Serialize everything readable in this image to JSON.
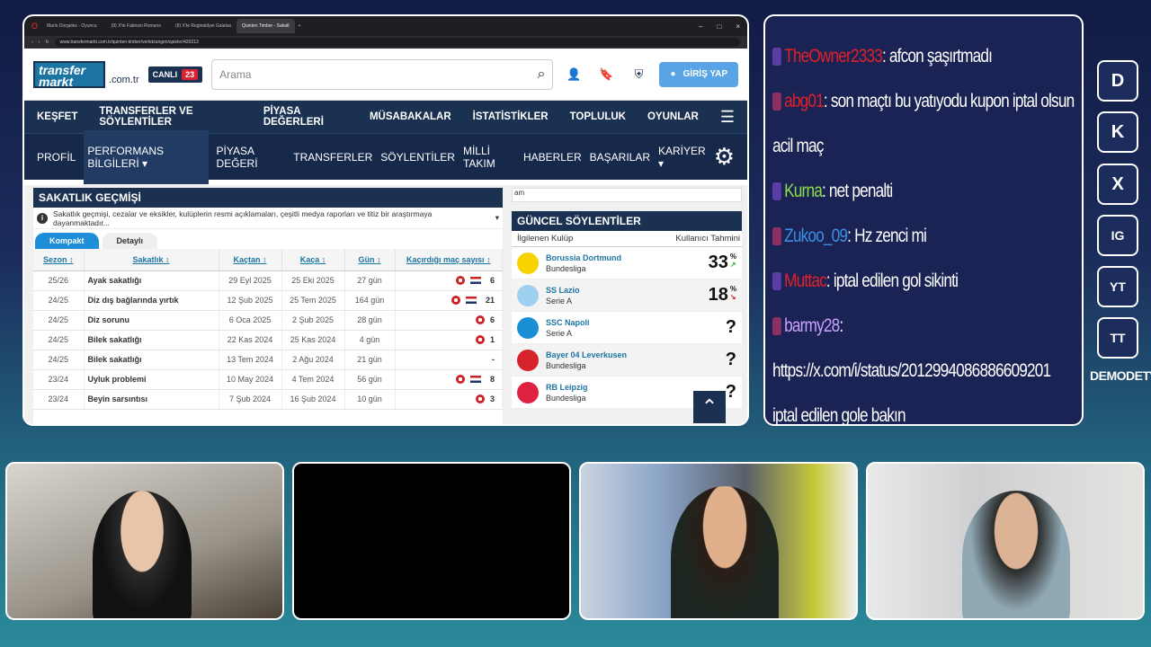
{
  "browser": {
    "tabs": [
      "Mario Dorgeles - Oyuncu",
      "(9) X'te Fabrizio Romano",
      "(9) X'te Reginaldyei Galatas",
      "Quinten Timber - Sakatl"
    ],
    "url": "www.transfermarkt.com.tr/quinten-timber/verletzungen/spieler/420213"
  },
  "site": {
    "logo_line1": "transfer",
    "logo_line2": "markt",
    "domain": ".com.tr",
    "live_label": "CANLI",
    "live_count": "23",
    "search_placeholder": "Arama",
    "login_label": "GİRİŞ YAP",
    "main_nav": [
      "KEŞFET",
      "TRANSFERLER VE SÖYLENTİLER",
      "PİYASA DEĞERLERİ",
      "MÜSABAKALAR",
      "İSTATİSTİKLER",
      "TOPLULUK",
      "OYUNLAR"
    ],
    "sub_nav": [
      "PROFİL",
      "PERFORMANS BİLGİLERİ",
      "PİYASA DEĞERİ",
      "TRANSFERLER",
      "SÖYLENTİLER",
      "MİLLİ TAKIM",
      "HABERLER",
      "BAŞARILAR",
      "KARİYER"
    ]
  },
  "injury": {
    "title": "SAKATLIK GEÇMİŞİ",
    "info": "Sakatlık geçmişi, cezalar ve eksikler, kulüplerin resmi açıklamaları, çeşitli medya raporları ve titiz bir araştırmaya dayanmaktadır...",
    "tab_compact": "Kompakt",
    "tab_detail": "Detaylı",
    "headers": [
      "Sezon ↕",
      "Sakatlık ↕",
      "Kaçtan ↕",
      "Kaça ↕",
      "Gün ↕",
      "Kaçırdığı maç sayısı ↕"
    ],
    "rows": [
      {
        "season": "25/26",
        "type": "Ayak sakatlığı",
        "from": "29 Eyl 2025",
        "to": "25 Eki 2025",
        "days": "27 gün",
        "missed": "6"
      },
      {
        "season": "24/25",
        "type": "Diz dış bağlarında yırtık",
        "from": "12 Şub 2025",
        "to": "25 Tem 2025",
        "days": "164 gün",
        "missed": "21"
      },
      {
        "season": "24/25",
        "type": "Diz sorunu",
        "from": "6 Oca 2025",
        "to": "2 Şub 2025",
        "days": "28 gün",
        "missed": "6"
      },
      {
        "season": "24/25",
        "type": "Bilek sakatlığı",
        "from": "22 Kas 2024",
        "to": "25 Kas 2024",
        "days": "4 gün",
        "missed": "1"
      },
      {
        "season": "24/25",
        "type": "Bilek sakatlığı",
        "from": "13 Tem 2024",
        "to": "2 Ağu 2024",
        "days": "21 gün",
        "missed": "-"
      },
      {
        "season": "23/24",
        "type": "Uyluk problemi",
        "from": "10 May 2024",
        "to": "4 Tem 2024",
        "days": "56 gün",
        "missed": "8"
      },
      {
        "season": "23/24",
        "type": "Beyin sarsıntısı",
        "from": "7 Şub 2024",
        "to": "16 Şub 2024",
        "days": "10 gün",
        "missed": "3"
      }
    ]
  },
  "rumours": {
    "input_value": "am",
    "title": "GÜNCEL SÖYLENTİLER",
    "col_club": "İlgilenen Kulüp",
    "col_pred": "Kullanıcı Tahmini",
    "items": [
      {
        "club": "Borussia Dortmund",
        "league": "Bundesliga",
        "pct": "33",
        "trend": "up",
        "color": "#f7d300"
      },
      {
        "club": "SS Lazio",
        "league": "Serie A",
        "pct": "18",
        "trend": "down",
        "color": "#9fd0f0"
      },
      {
        "club": "SSC Napoli",
        "league": "Serie A",
        "pct": "?",
        "trend": "",
        "color": "#1a8fd6"
      },
      {
        "club": "Bayer 04 Leverkusen",
        "league": "Bundesliga",
        "pct": "?",
        "trend": "",
        "color": "#d6222a"
      },
      {
        "club": "RB Leipzig",
        "league": "Bundesliga",
        "pct": "?",
        "trend": "",
        "color": "#dd2244"
      }
    ]
  },
  "chat": [
    {
      "user": "TheOwner2333",
      "color": "#e0202a",
      "text": ": afcon şaşırtmadı"
    },
    {
      "user": "abg01",
      "color": "#e0202a",
      "text": ": son maçtı bu yatıyodu kupon iptal olsun acil maç"
    },
    {
      "user": "Kurna",
      "color": "#8be04a",
      "text": ": net penalti"
    },
    {
      "user": "Zukoo_09",
      "color": "#3b8fe6",
      "text": ": Hz zenci mi"
    },
    {
      "user": "Muttac",
      "color": "#e0202a",
      "text": ": iptal edilen gol sikinti"
    },
    {
      "user": "barmy28",
      "color": "#c9a0ff",
      "text": ": https://x.com/i/status/2012994086886609201 iptal edilen gole bakın"
    }
  ],
  "socials": [
    "D",
    "K",
    "X",
    "IG",
    "YT",
    "TT"
  ],
  "channel": "DEMODETV"
}
